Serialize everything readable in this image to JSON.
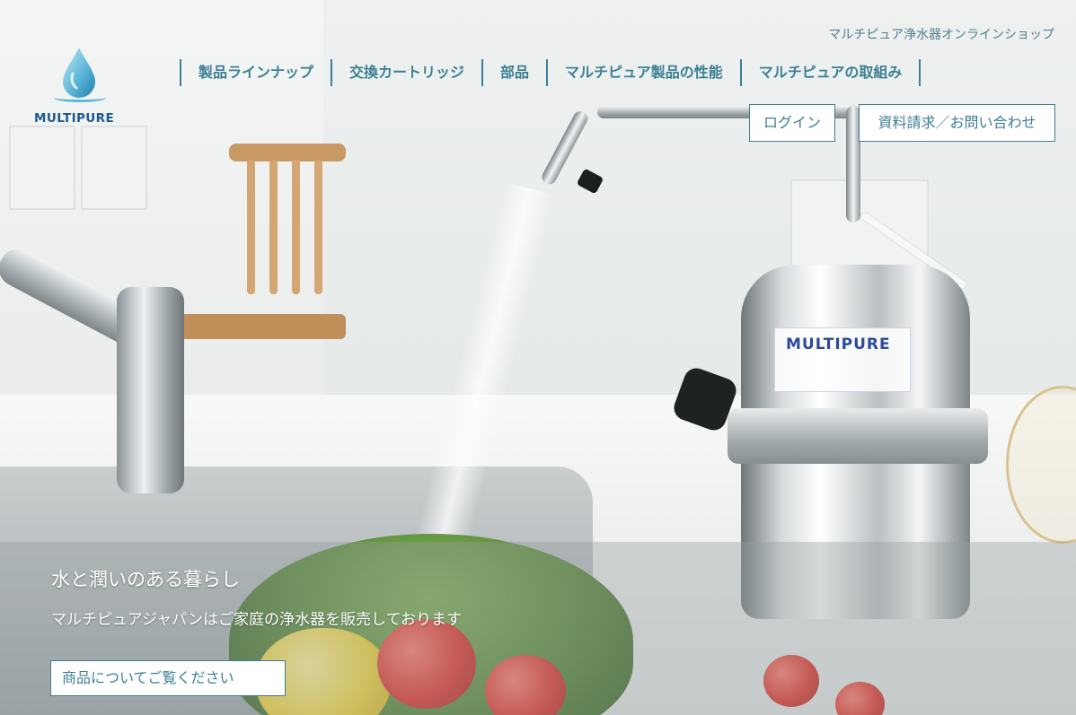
{
  "header": {
    "shop_title": "マルチピュア浄水器オンラインショップ",
    "logo_text": "MULTIPURE",
    "nav": [
      {
        "label": "製品ラインナップ"
      },
      {
        "label": "交換カートリッジ"
      },
      {
        "label": "部品"
      },
      {
        "label": "マルチピュア製品の性能"
      },
      {
        "label": "マルチピュアの取組み"
      }
    ],
    "login_label": "ログイン",
    "contact_label": "資料請求／お問い合わせ"
  },
  "hero": {
    "title": "水と潤いのある暮らし",
    "subtitle": "マルチピュアジャパンはご家庭の浄水器を販売しております",
    "cta_label": "商品についてご覧ください",
    "product_label": "MULTIPURE"
  },
  "colors": {
    "accent": "#3d7f93",
    "logo_blue": "#1f5a8e",
    "drop_light": "#8fd0ea"
  },
  "icons": {
    "logo": "water-drop-icon"
  }
}
